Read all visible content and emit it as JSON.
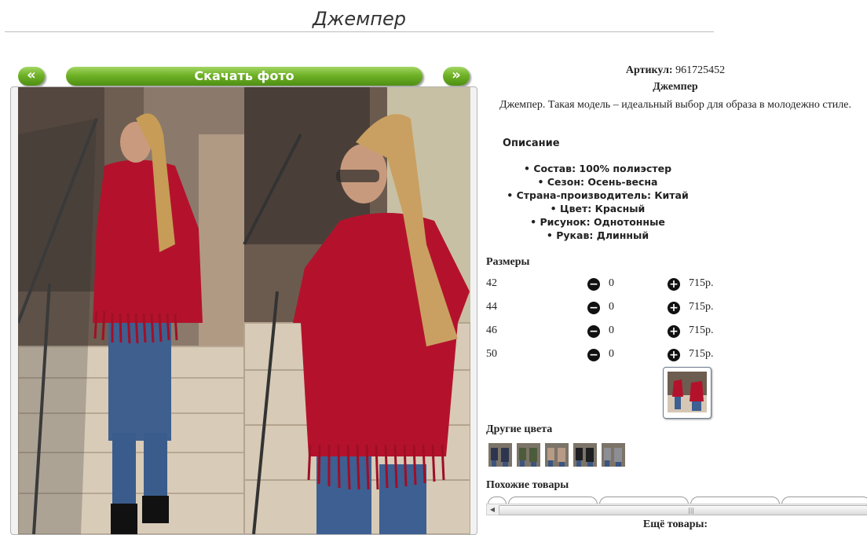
{
  "page": {
    "title": "Джемпер"
  },
  "gallery": {
    "prev_label": "«",
    "next_label": "»",
    "download_label": "Скачать фото"
  },
  "product": {
    "article_label": "Артикул:",
    "article_value": "961725452",
    "name": "Джемпер",
    "description": "Джемпер. Такая модель – идеальный выбор для образа в молодежно стиле.",
    "description_heading": "Описание",
    "properties": [
      "Состав: 100% полиэстер",
      "Сезон: Осень-весна",
      "Страна-производитель: Китай",
      "Цвет: Красный",
      "Рисунок: Однотонные",
      "Рукав: Длинный"
    ]
  },
  "sizes": {
    "heading": "Размеры",
    "minus_icon": "−",
    "plus_icon": "+",
    "rows": [
      {
        "size": "42",
        "qty": "0",
        "price": "715р."
      },
      {
        "size": "44",
        "qty": "0",
        "price": "715р."
      },
      {
        "size": "46",
        "qty": "0",
        "price": "715р."
      },
      {
        "size": "50",
        "qty": "0",
        "price": "715р."
      }
    ]
  },
  "other_colors": {
    "heading": "Другие цвета",
    "swatches": [
      {
        "icon": "swatch-navy",
        "color": "#2d3550"
      },
      {
        "icon": "swatch-green",
        "color": "#4c5b3a"
      },
      {
        "icon": "swatch-beige",
        "color": "#b79b86"
      },
      {
        "icon": "swatch-black",
        "color": "#1f1f22"
      },
      {
        "icon": "swatch-grey",
        "color": "#8c8e93"
      }
    ]
  },
  "similar": {
    "heading": "Похожие товары"
  },
  "more": {
    "heading": "Ещё товары:"
  },
  "colors": {
    "accent_green": "#6fb126",
    "garment_red": "#b4122c"
  }
}
